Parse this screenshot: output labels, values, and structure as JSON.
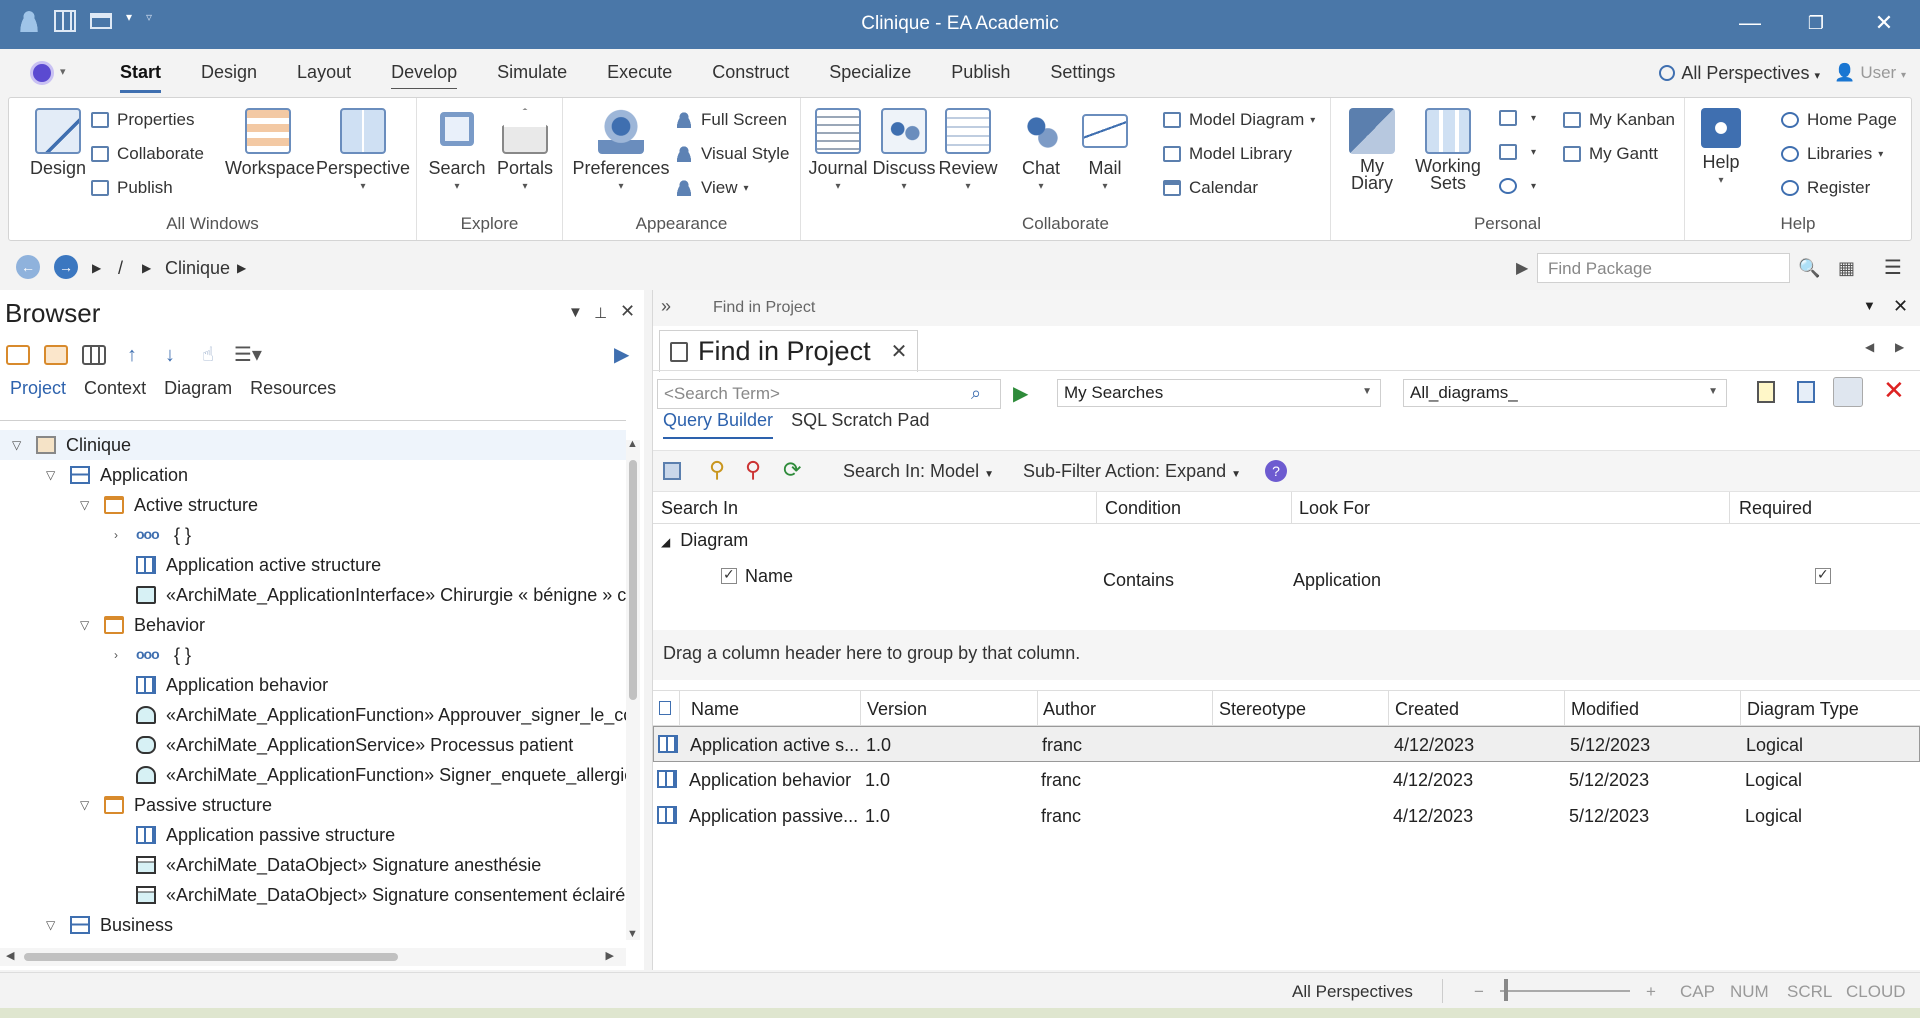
{
  "window": {
    "title": "Clinique - EA Academic"
  },
  "menu": {
    "tabs": [
      "Start",
      "Design",
      "Layout",
      "Develop",
      "Simulate",
      "Execute",
      "Construct",
      "Specialize",
      "Publish",
      "Settings"
    ],
    "perspectives": "All Perspectives",
    "user": "User"
  },
  "ribbon": {
    "all_windows": {
      "label": "All Windows",
      "design": "Design",
      "properties": "Properties",
      "collaborate": "Collaborate",
      "publish": "Publish",
      "workspace": "Workspace",
      "perspective": "Perspective"
    },
    "explore": {
      "label": "Explore",
      "search": "Search",
      "portals": "Portals"
    },
    "appearance": {
      "label": "Appearance",
      "preferences": "Preferences",
      "full_screen": "Full Screen",
      "visual_style": "Visual Style",
      "view": "View"
    },
    "collaborate": {
      "label": "Collaborate",
      "journal": "Journal",
      "discuss": "Discuss",
      "review": "Review",
      "chat": "Chat",
      "mail": "Mail",
      "model_diagram": "Model Diagram",
      "model_library": "Model Library",
      "calendar": "Calendar"
    },
    "personal": {
      "label": "Personal",
      "my_diary": "My Diary",
      "working_sets": "Working Sets",
      "my_kanban": "My Kanban",
      "my_gantt": "My Gantt"
    },
    "help": {
      "label": "Help",
      "help": "Help",
      "home_page": "Home Page",
      "libraries": "Libraries",
      "register": "Register"
    }
  },
  "breadcrumb": {
    "root": "/",
    "item": "Clinique",
    "find_placeholder": "Find Package"
  },
  "browser": {
    "title": "Browser",
    "tabs": [
      "Project",
      "Context",
      "Diagram",
      "Resources"
    ],
    "tree": [
      "Clinique",
      "Application",
      "Active structure",
      "{ }",
      "Application active structure",
      "«ArchiMate_ApplicationInterface» Chirurgie « bénigne » c",
      "Behavior",
      "{ }",
      "Application behavior",
      "«ArchiMate_ApplicationFunction» Approuver_signer_le_cc",
      "«ArchiMate_ApplicationService» Processus patient",
      "«ArchiMate_ApplicationFunction» Signer_enquete_allergie",
      "Passive structure",
      "Application passive structure",
      "«ArchiMate_DataObject» Signature anesthésie",
      "«ArchiMate_DataObject» Signature consentement éclairé",
      "Business"
    ]
  },
  "find": {
    "header": "Find in Project",
    "tab_title": "Find in Project",
    "search_placeholder": "<Search Term>",
    "my_searches": "My Searches",
    "search_name": "All_diagrams_",
    "query_tabs": [
      "Query Builder",
      "SQL Scratch Pad"
    ],
    "search_in": "Search In: Model",
    "sub_filter": "Sub-Filter Action: Expand",
    "query_columns": [
      "Search In",
      "Condition",
      "Look For",
      "Required"
    ],
    "query_group": "Diagram",
    "query_row": {
      "field": "Name",
      "condition": "Contains",
      "look_for": "Application"
    },
    "drag_hint": "Drag a column header here to group by that column.",
    "result_columns": [
      "Name",
      "Version",
      "Author",
      "Stereotype",
      "Created",
      "Modified",
      "Diagram Type"
    ],
    "results": [
      {
        "name": "Application active s...",
        "version": "1.0",
        "author": "franc",
        "stereotype": "",
        "created": "4/12/2023",
        "modified": "5/12/2023",
        "type": "Logical"
      },
      {
        "name": "Application behavior",
        "version": "1.0",
        "author": "franc",
        "stereotype": "",
        "created": "4/12/2023",
        "modified": "5/12/2023",
        "type": "Logical"
      },
      {
        "name": "Application passive...",
        "version": "1.0",
        "author": "franc",
        "stereotype": "",
        "created": "4/12/2023",
        "modified": "5/12/2023",
        "type": "Logical"
      }
    ]
  },
  "status": {
    "perspectives": "All Perspectives",
    "minus": "−",
    "plus": "+",
    "cap": "CAP",
    "num": "NUM",
    "scrl": "SCRL",
    "cloud": "CLOUD"
  }
}
